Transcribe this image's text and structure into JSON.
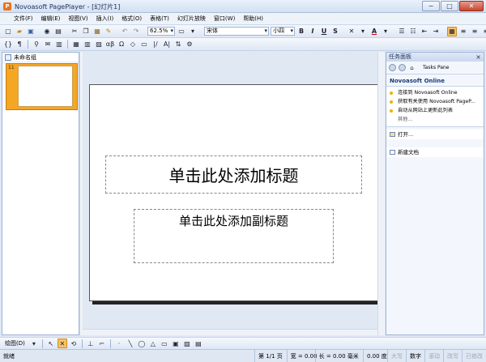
{
  "window": {
    "title": "Novoasoft PagePlayer - [幻灯片1]",
    "app_icon_glyph": "P",
    "controls": {
      "minimize": "−",
      "maximize": "□",
      "close": "✕"
    }
  },
  "menu": [
    "文件(F)",
    "编辑(E)",
    "视图(V)",
    "插入(I)",
    "格式(O)",
    "表格(T)",
    "幻灯片放映",
    "窗口(W)",
    "帮助(H)"
  ],
  "toolbar": {
    "zoom": "62.5%",
    "font_name": "宋体",
    "font_size": "小四",
    "bold": "B",
    "italic": "I",
    "underline": "U",
    "strike": "S",
    "font_color": "A"
  },
  "toolbar2": {
    "glyphs": [
      "{}",
      "¶",
      "αβ",
      "Ω",
      "|/",
      "A|"
    ]
  },
  "left_panel": {
    "group_name": "未命名组",
    "slide_number": "11"
  },
  "slide": {
    "title_placeholder": "单击此处添加标题",
    "subtitle_placeholder": "单击此处添加副标题"
  },
  "task_pane": {
    "header": "任务面板",
    "nav_label": "Tasks Pane",
    "section_title": "Novoasoft Online",
    "online_links": [
      "连接到 Novoasoft Online",
      "获取有关使用 Novoasoft PageP...",
      "自动从网站上更新此列表"
    ],
    "more": "其他...",
    "open_label": "打开...",
    "new_doc_label": "新建文档"
  },
  "drawbar": {
    "label": "绘图(D)"
  },
  "status": {
    "ready": "就绪",
    "slide_pos": "第 1/1 页",
    "width": "宽 = 0.00",
    "height": "长 = 0.00 毫米",
    "angle": "0.00 度",
    "caps": "大写",
    "num": "数字",
    "scroll": "滚动",
    "ovr": "改写",
    "ext": "已修改"
  },
  "colors": {
    "accent": "#f5a623",
    "chrome": "#dfe8f6",
    "title_text": "#1d2f57"
  }
}
